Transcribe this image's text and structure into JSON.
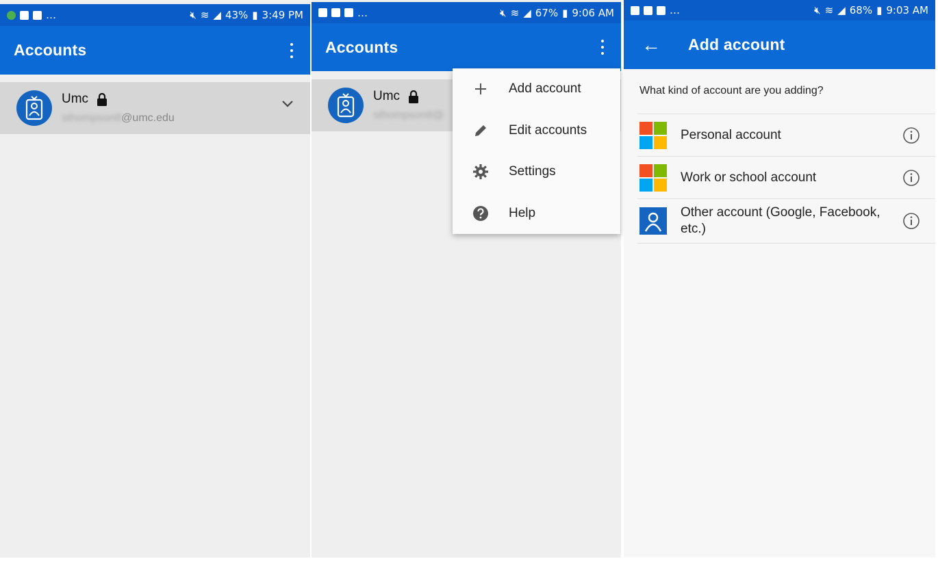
{
  "screens": [
    {
      "status": {
        "battery": "43%",
        "time": "3:49 PM"
      },
      "title": "Accounts",
      "account": {
        "name": "Umc",
        "email_user": "sthompson8",
        "email_domain": "@umc.edu"
      }
    },
    {
      "status": {
        "battery": "67%",
        "time": "9:06 AM"
      },
      "title": "Accounts",
      "account": {
        "name": "Umc",
        "email_user": "sthompson8@"
      },
      "menu": [
        {
          "label": "Add account",
          "icon": "plus-icon"
        },
        {
          "label": "Edit accounts",
          "icon": "pencil-icon"
        },
        {
          "label": "Settings",
          "icon": "gear-icon"
        },
        {
          "label": "Help",
          "icon": "help-icon"
        }
      ]
    },
    {
      "status": {
        "battery": "68%",
        "time": "9:03 AM"
      },
      "title": "Add account",
      "question": "What kind of account are you adding?",
      "options": [
        {
          "label": "Personal account",
          "icon": "microsoft-logo-icon"
        },
        {
          "label": "Work or school account",
          "icon": "microsoft-logo-icon"
        },
        {
          "label": "Other account (Google, Facebook, etc.)",
          "icon": "person-icon"
        }
      ]
    }
  ],
  "colors": {
    "primary": "#0b6ad6",
    "statusbar": "#0a5cc8",
    "avatar": "#1565c0"
  },
  "status_icons": [
    "notification-icons",
    "mute-icon",
    "wifi-icon",
    "signal-icon",
    "battery-icon"
  ]
}
